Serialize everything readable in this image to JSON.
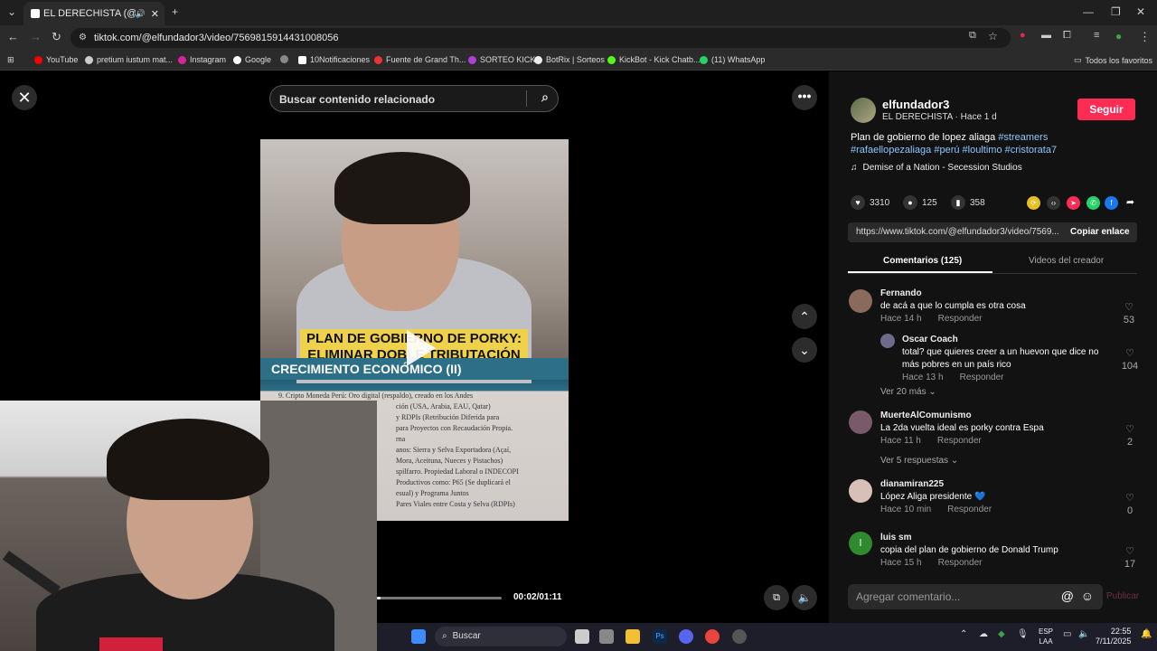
{
  "browser": {
    "tab_title": "EL DERECHISTA (@elfunda",
    "url": "tiktok.com/@elfundador3/video/7569815914431008056",
    "bookmarks": [
      "YouTube",
      "pretium iustum mat...",
      "Instagram",
      "Google",
      "10Notificaciones",
      "Fuente de Grand Th...",
      "SORTEO KICK",
      "BotRix | Sorteos",
      "KickBot - Kick Chatb...",
      "(11) WhatsApp"
    ],
    "all_favorites": "Todos los favoritos"
  },
  "player": {
    "search_placeholder": "Buscar contenido relacionado",
    "overlay_line1": "PLAN DE GOBIERNO DE PORKY:",
    "overlay_line2": "ELIMINAR DOBLE TRIBUTACIÓN",
    "doc_band": "CRECIMIENTO ECONÓMICO (II)",
    "doc_lines": [
      "9.  Cripto Moneda Perú: Oro digital (respaldo), creado en los Andes",
      "ción (USA, Arabia, EAU, Qatar)",
      "y  RDPIs  (Retribución  Diferida  para",
      "para Proyectos con Recaudación Propia.",
      "rna",
      "anos: Sierra y Selva Exportadora (Açaí,",
      "Mora, Aceituna, Nueces y Pistachos)",
      "spilfarro. Propiedad Laboral o INDECOPI",
      "Productivos como: P65 (Se duplicará el",
      "esual) y Programa Juntos",
      "Pares Viales entre Costa y Selva (RDPIs)"
    ],
    "timecode": "00:02/01:11",
    "progress": 0.03
  },
  "post": {
    "username": "elfundador3",
    "display_meta": "EL DERECHISTA · Hace 1 d",
    "follow_label": "Seguir",
    "description": "Plan de gobierno de lopez aliaga",
    "hashtags_line1": "#streamers",
    "hashtags_line2": "#rafaellopezaliaga #perú #loultimo #cristorata7",
    "music": "Demise of a Nation - Secession Studios",
    "likes": "3310",
    "comments": "125",
    "saves": "358",
    "link": "https://www.tiktok.com/@elfundador3/video/7569...",
    "copy_label": "Copiar enlace",
    "tab_comments": "Comentarios (125)",
    "tab_creator": "Videos del creador"
  },
  "comments": [
    {
      "name": "Fernando",
      "text": "de acá a que lo cumpla es otra cosa",
      "time": "Hace 14 h",
      "reply": "Responder",
      "likes": "53"
    },
    {
      "name": "Oscar Coach",
      "text": "total? que quieres creer a un huevon que dice no más pobres en un país rico",
      "time": "Hace 13 h",
      "reply": "Responder",
      "likes": "104"
    },
    {
      "name": "MuerteAlComunismo",
      "text": "La 2da vuelta ideal es porky contra Espa",
      "time": "Hace 11 h",
      "reply": "Responder",
      "likes": "2"
    },
    {
      "name": "dianamiran225",
      "text": "López Aliga presidente 💙",
      "time": "Hace 10 min",
      "reply": "Responder",
      "likes": "0"
    },
    {
      "name": "luis sm",
      "text": "copia del plan de gobierno de Donald Trump",
      "time": "Hace 15 h",
      "reply": "Responder",
      "likes": "17"
    }
  ],
  "more_replies": [
    "Ver 20 más",
    "Ver 5 respuestas"
  ],
  "comment_box": {
    "placeholder": "Agregar comentario...",
    "publish": "Publicar"
  },
  "taskbar": {
    "search": "Buscar",
    "lang1": "ESP",
    "lang2": "LAA",
    "time": "22:55",
    "date": "7/11/2025"
  }
}
